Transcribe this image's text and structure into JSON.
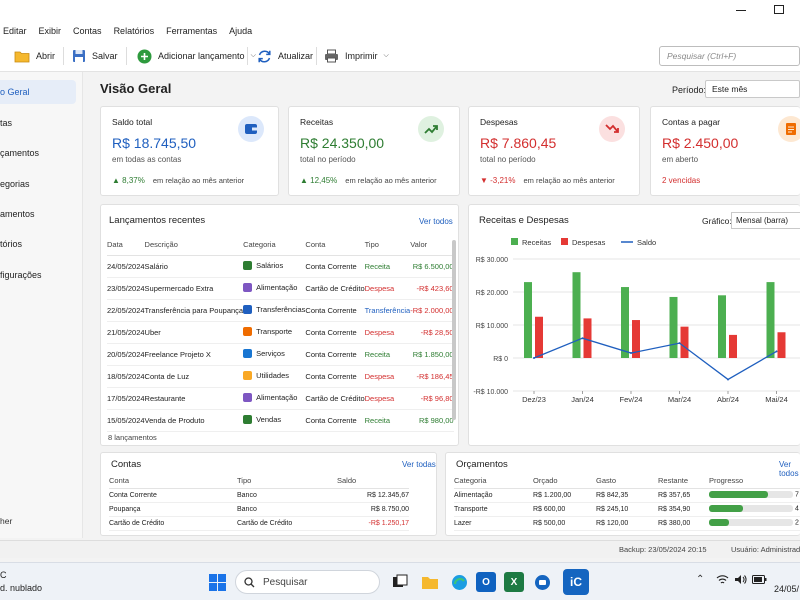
{
  "menu": [
    "Editar",
    "Exibir",
    "Contas",
    "Relatórios",
    "Ferramentas",
    "Ajuda"
  ],
  "toolbar": {
    "open": "Abrir",
    "save": "Salvar",
    "add": "Adicionar lançamento",
    "refresh": "Atualizar",
    "print": "Imprimir",
    "search_placeholder": "Pesquisar (Ctrl+F)"
  },
  "sidebar": {
    "items": [
      "o Geral",
      "tas",
      "çamentos",
      "egorias",
      "amentos",
      "tórios",
      "figurações"
    ],
    "footer": "her"
  },
  "header": {
    "title": "Visão Geral",
    "period_label": "Período:",
    "period_value": "Este mês"
  },
  "kpis": [
    {
      "title": "Saldo total",
      "value": "R$ 18.745,50",
      "sub": "em todas as contas",
      "trend": "▲ 8,37%",
      "compare": "em relação ao mês anterior",
      "color": "#1f5fbf",
      "icon": "wallet-icon"
    },
    {
      "title": "Receitas",
      "value": "R$ 24.350,00",
      "sub": "total no período",
      "trend": "▲ 12,45%",
      "compare": "em relação ao mês anterior",
      "color": "#2e7d32",
      "icon": "trend-up-icon"
    },
    {
      "title": "Despesas",
      "value": "R$ 7.860,45",
      "sub": "total no período",
      "trend": "▼ -3,21%",
      "compare": "em relação ao mês anterior",
      "color": "#d32f2f",
      "icon": "trend-down-icon"
    },
    {
      "title": "Contas a pagar",
      "value": "R$ 2.450,00",
      "sub": "em aberto",
      "alert": "2 vencidas",
      "color": "#d32f2f",
      "icon": "document-icon"
    }
  ],
  "recent": {
    "title": "Lançamentos recentes",
    "see_all": "Ver todos",
    "columns": [
      "Data",
      "Descrição",
      "Categoria",
      "Conta",
      "Tipo",
      "Valor"
    ],
    "rows": [
      {
        "date": "24/05/2024",
        "desc": "Salário",
        "cat": "Salários",
        "cat_color": "#2e7d32",
        "account": "Conta Corrente",
        "type": "Receita",
        "value": "R$ 6.500,00"
      },
      {
        "date": "23/05/2024",
        "desc": "Supermercado Extra",
        "cat": "Alimentação",
        "cat_color": "#7e57c2",
        "account": "Cartão de Crédito",
        "type": "Despesa",
        "value": "-R$ 423,60"
      },
      {
        "date": "22/05/2024",
        "desc": "Transferência para Poupança",
        "cat": "Transferências",
        "cat_color": "#1f5fbf",
        "account": "Conta Corrente",
        "type": "Transferência",
        "value": "-R$ 2.000,00"
      },
      {
        "date": "21/05/2024",
        "desc": "Uber",
        "cat": "Transporte",
        "cat_color": "#ef6c00",
        "account": "Conta Corrente",
        "type": "Despesa",
        "value": "-R$ 28,50"
      },
      {
        "date": "20/05/2024",
        "desc": "Freelance Projeto X",
        "cat": "Serviços",
        "cat_color": "#1976d2",
        "account": "Conta Corrente",
        "type": "Receita",
        "value": "R$ 1.850,00"
      },
      {
        "date": "18/05/2024",
        "desc": "Conta de Luz",
        "cat": "Utilidades",
        "cat_color": "#f9a825",
        "account": "Conta Corrente",
        "type": "Despesa",
        "value": "-R$ 186,45"
      },
      {
        "date": "17/05/2024",
        "desc": "Restaurante",
        "cat": "Alimentação",
        "cat_color": "#7e57c2",
        "account": "Cartão de Crédito",
        "type": "Despesa",
        "value": "-R$ 96,80"
      },
      {
        "date": "15/05/2024",
        "desc": "Venda de Produto",
        "cat": "Vendas",
        "cat_color": "#2e7d32",
        "account": "Conta Corrente",
        "type": "Receita",
        "value": "R$ 980,00"
      }
    ],
    "count": "8 lançamentos"
  },
  "chart_panel": {
    "title": "Receitas e Despesas",
    "type_label": "Gráfico:",
    "type_value": "Mensal (barra)"
  },
  "chart_data": {
    "type": "bar",
    "categories": [
      "Dez/23",
      "Jan/24",
      "Fev/24",
      "Mar/24",
      "Abr/24",
      "Mai/24"
    ],
    "series": [
      {
        "name": "Receitas",
        "kind": "bar",
        "color": "#4caf50",
        "values": [
          23000,
          26000,
          21500,
          18500,
          19000,
          23000
        ]
      },
      {
        "name": "Despesas",
        "kind": "bar",
        "color": "#e53935",
        "values": [
          12500,
          12000,
          11500,
          9500,
          7000,
          7800
        ]
      },
      {
        "name": "Saldo",
        "kind": "line",
        "color": "#1f5fbf",
        "values": [
          0,
          6000,
          1500,
          4500,
          -6500,
          2000
        ]
      }
    ],
    "ylim": [
      -10000,
      30000
    ],
    "yticks": [
      -10000,
      0,
      10000,
      20000,
      30000
    ],
    "ytick_labels": [
      "-R$ 10.000",
      "R$ 0",
      "R$ 10.000",
      "R$ 20.000",
      "R$ 30.000"
    ],
    "grid": true,
    "legend": "top"
  },
  "accounts": {
    "title": "Contas",
    "see_all": "Ver todas",
    "columns": [
      "Conta",
      "Tipo",
      "Saldo"
    ],
    "rows": [
      {
        "name": "Conta Corrente",
        "type": "Banco",
        "balance": "R$ 12.345,67"
      },
      {
        "name": "Poupança",
        "type": "Banco",
        "balance": "R$ 8.750,00"
      },
      {
        "name": "Cartão de Crédito",
        "type": "Cartão de Crédito",
        "balance": "-R$ 1.250,17"
      }
    ]
  },
  "budgets": {
    "title": "Orçamentos",
    "see_all": "Ver todos",
    "columns": [
      "Categoria",
      "Orçado",
      "Gasto",
      "Restante",
      "Progresso"
    ],
    "rows": [
      {
        "cat": "Alimentação",
        "budget": "R$ 1.200,00",
        "spent": "R$ 842,35",
        "left": "R$ 357,65",
        "progress": 0.7,
        "pct": "7"
      },
      {
        "cat": "Transporte",
        "budget": "R$ 600,00",
        "spent": "R$ 245,10",
        "left": "R$ 354,90",
        "progress": 0.41,
        "pct": "4"
      },
      {
        "cat": "Lazer",
        "budget": "R$ 500,00",
        "spent": "R$ 120,00",
        "left": "R$ 380,00",
        "progress": 0.24,
        "pct": "2"
      }
    ]
  },
  "status": {
    "backup": "Backup: 23/05/2024 20:15",
    "user": "Usuário: Administrado"
  },
  "taskbar": {
    "weather_temp": "C",
    "weather_desc": "d. nublado",
    "search": "Pesquisar",
    "date": "24/05/"
  }
}
